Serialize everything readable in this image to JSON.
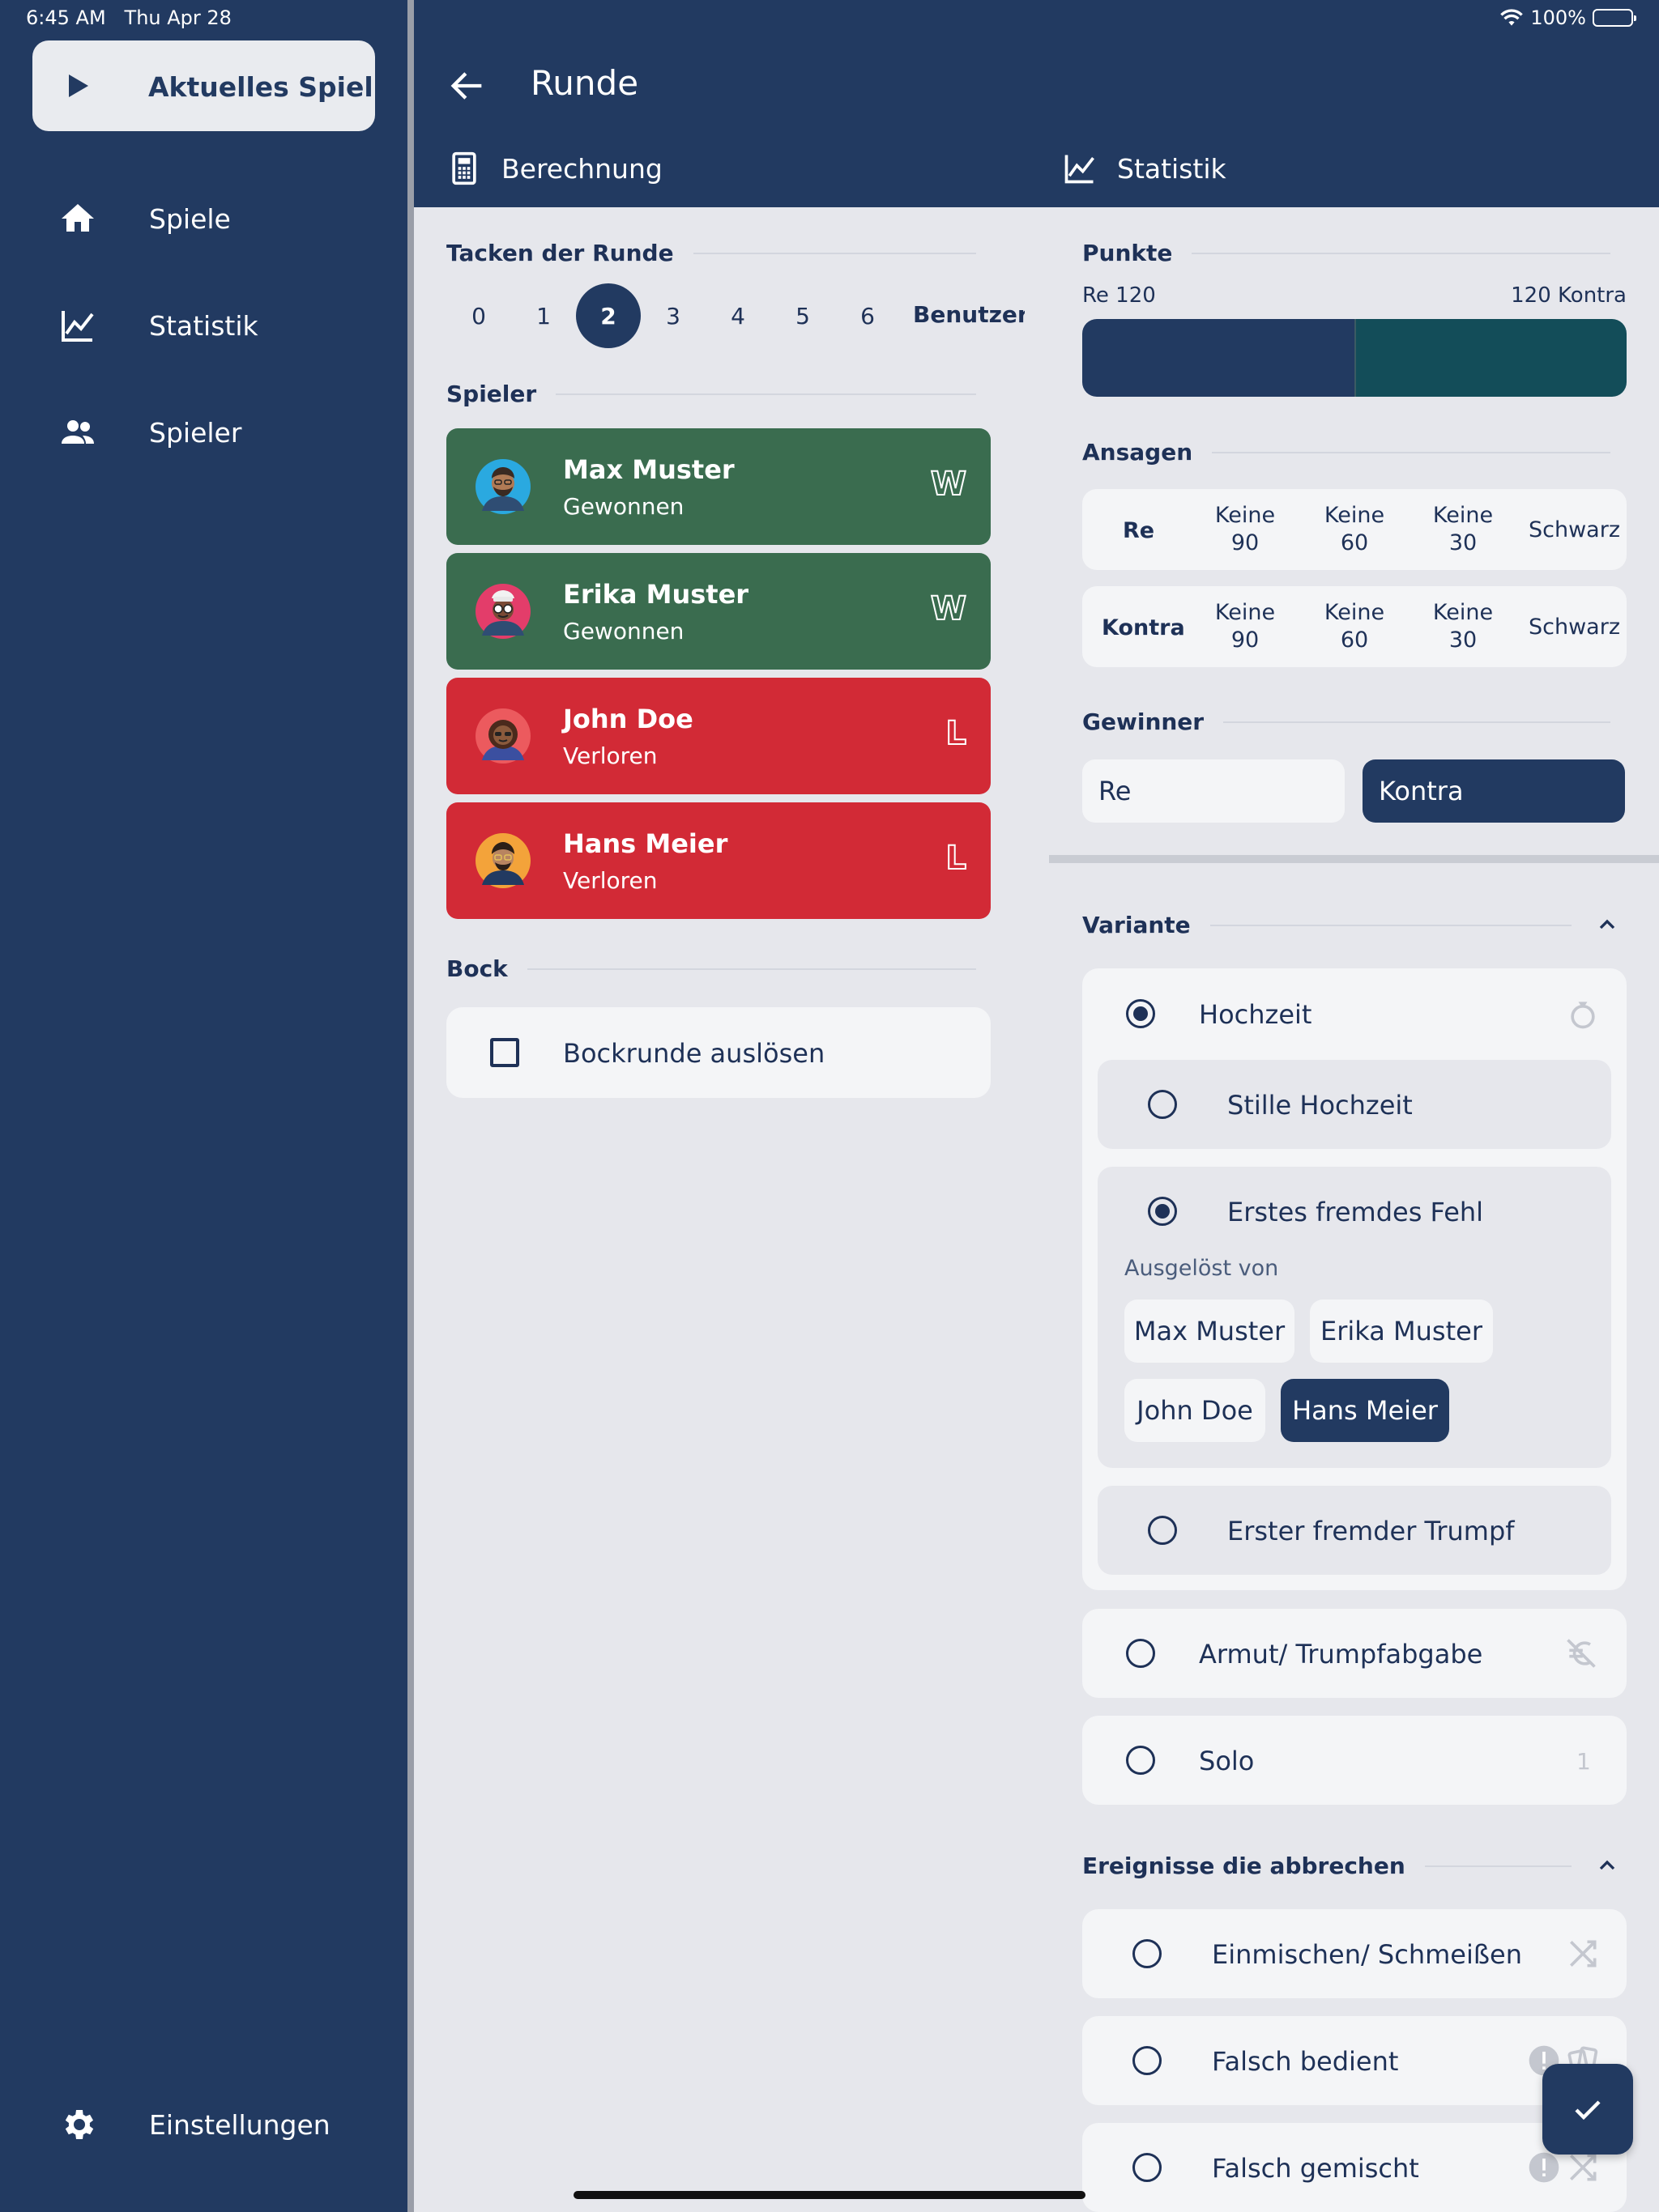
{
  "status": {
    "time": "6:45 AM",
    "date": "Thu Apr 28",
    "battery": "100%"
  },
  "sidebar": {
    "current_game": "Aktuelles Spiel",
    "items": [
      {
        "label": "Spiele",
        "icon": "home-icon"
      },
      {
        "label": "Statistik",
        "icon": "chart-icon"
      },
      {
        "label": "Spieler",
        "icon": "people-icon"
      }
    ],
    "settings": "Einstellungen"
  },
  "header": {
    "title": "Runde",
    "tabs": [
      {
        "label": "Berechnung",
        "icon": "calculator-icon"
      },
      {
        "label": "Statistik",
        "icon": "chart-icon"
      }
    ]
  },
  "tacken": {
    "title": "Tacken der Runde",
    "options": [
      "0",
      "1",
      "2",
      "3",
      "4",
      "5",
      "6"
    ],
    "selected": "2",
    "custom": "Benutzerdefiniert"
  },
  "players": {
    "title": "Spieler",
    "list": [
      {
        "name": "Max Muster",
        "status": "Gewonnen",
        "badge": "W"
      },
      {
        "name": "Erika Muster",
        "status": "Gewonnen",
        "badge": "W"
      },
      {
        "name": "John Doe",
        "status": "Verloren",
        "badge": "L"
      },
      {
        "name": "Hans Meier",
        "status": "Verloren",
        "badge": "L"
      }
    ]
  },
  "bock": {
    "title": "Bock",
    "label": "Bockrunde auslösen",
    "checked": false
  },
  "points": {
    "title": "Punkte",
    "left_label": "Re 120",
    "right_label": "120 Kontra",
    "re_share": 0.5,
    "colors": {
      "re": "#223a61",
      "kontra": "#134d59"
    }
  },
  "ansagen": {
    "title": "Ansagen",
    "rows": [
      {
        "team": "Re",
        "options": [
          [
            "Keine",
            "90"
          ],
          [
            "Keine",
            "60"
          ],
          [
            "Keine",
            "30"
          ],
          [
            "Schwarz"
          ]
        ]
      },
      {
        "team": "Kontra",
        "options": [
          [
            "Keine",
            "90"
          ],
          [
            "Keine",
            "60"
          ],
          [
            "Keine",
            "30"
          ],
          [
            "Schwarz"
          ]
        ]
      }
    ]
  },
  "gewinner": {
    "title": "Gewinner",
    "options": [
      "Re",
      "Kontra"
    ],
    "selected": "Kontra"
  },
  "variante": {
    "title": "Variante",
    "hochzeit": "Hochzeit",
    "stille_hochzeit": "Stille Hochzeit",
    "erstes_fremdes_fehl": "Erstes fremdes Fehl",
    "triggered_by_label": "Ausgelöst von",
    "triggered_by": [
      "Max Muster",
      "Erika Muster",
      "John Doe",
      "Hans Meier"
    ],
    "triggered_selected": "Hans Meier",
    "erster_fremder_trumpf": "Erster fremder Trumpf",
    "armut": "Armut/ Trumpfabgabe",
    "solo": "Solo",
    "solo_count": "1"
  },
  "ereignisse": {
    "title": "Ereignisse die abbrechen",
    "items": [
      "Einmischen/ Schmeißen",
      "Falsch bedient",
      "Falsch gemischt"
    ]
  },
  "accent_color": "#223a61"
}
